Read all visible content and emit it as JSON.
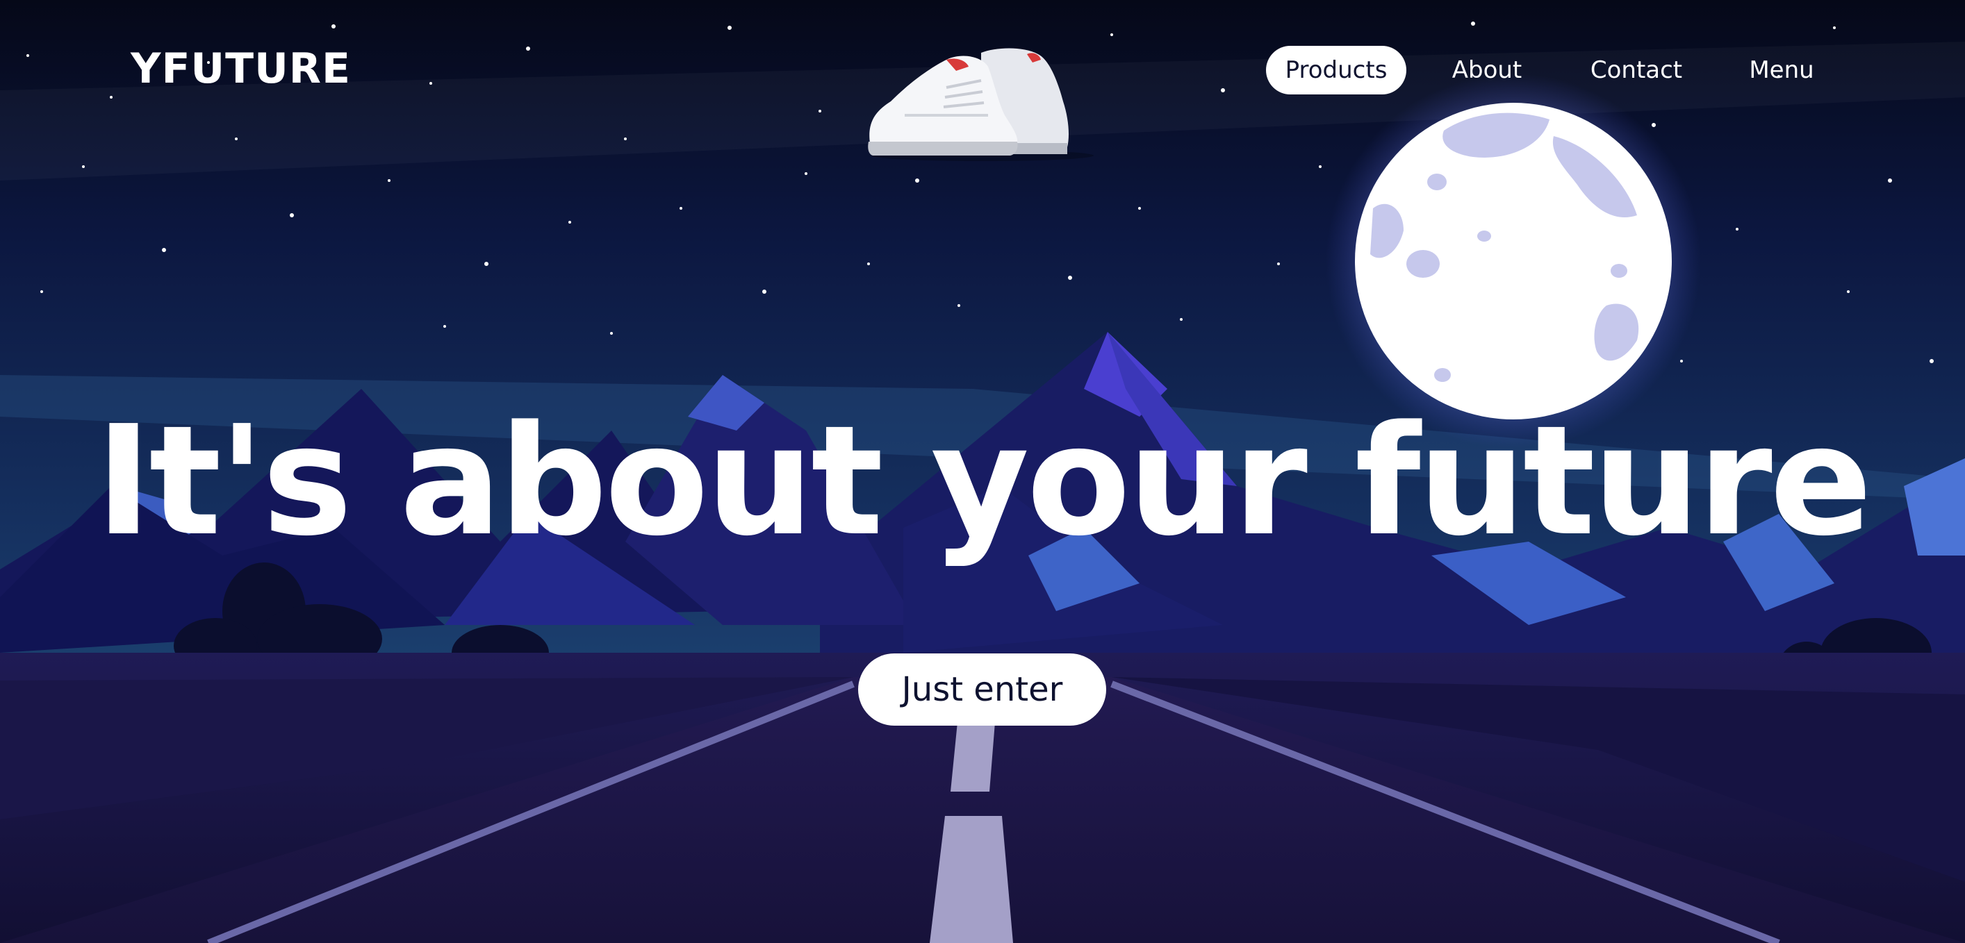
{
  "brand": {
    "logo_text": "YFUTURE"
  },
  "nav": {
    "items": [
      {
        "label": "Products",
        "active": true
      },
      {
        "label": "About",
        "active": false
      },
      {
        "label": "Contact",
        "active": false
      },
      {
        "label": "Menu",
        "active": false
      }
    ]
  },
  "hero": {
    "headline": "It's about your future",
    "cta_label": "Just enter",
    "product_icon": "sneakers-icon"
  },
  "colors": {
    "sky_top": "#050818",
    "sky_mid": "#13245a",
    "mountain_dark": "#151a5c",
    "mountain_light": "#3a5ac0",
    "moon": "#ffffff",
    "moon_crater": "#c6c8ec",
    "road": "#1e1747",
    "button_bg": "#ffffff",
    "button_text": "#0e1230"
  }
}
